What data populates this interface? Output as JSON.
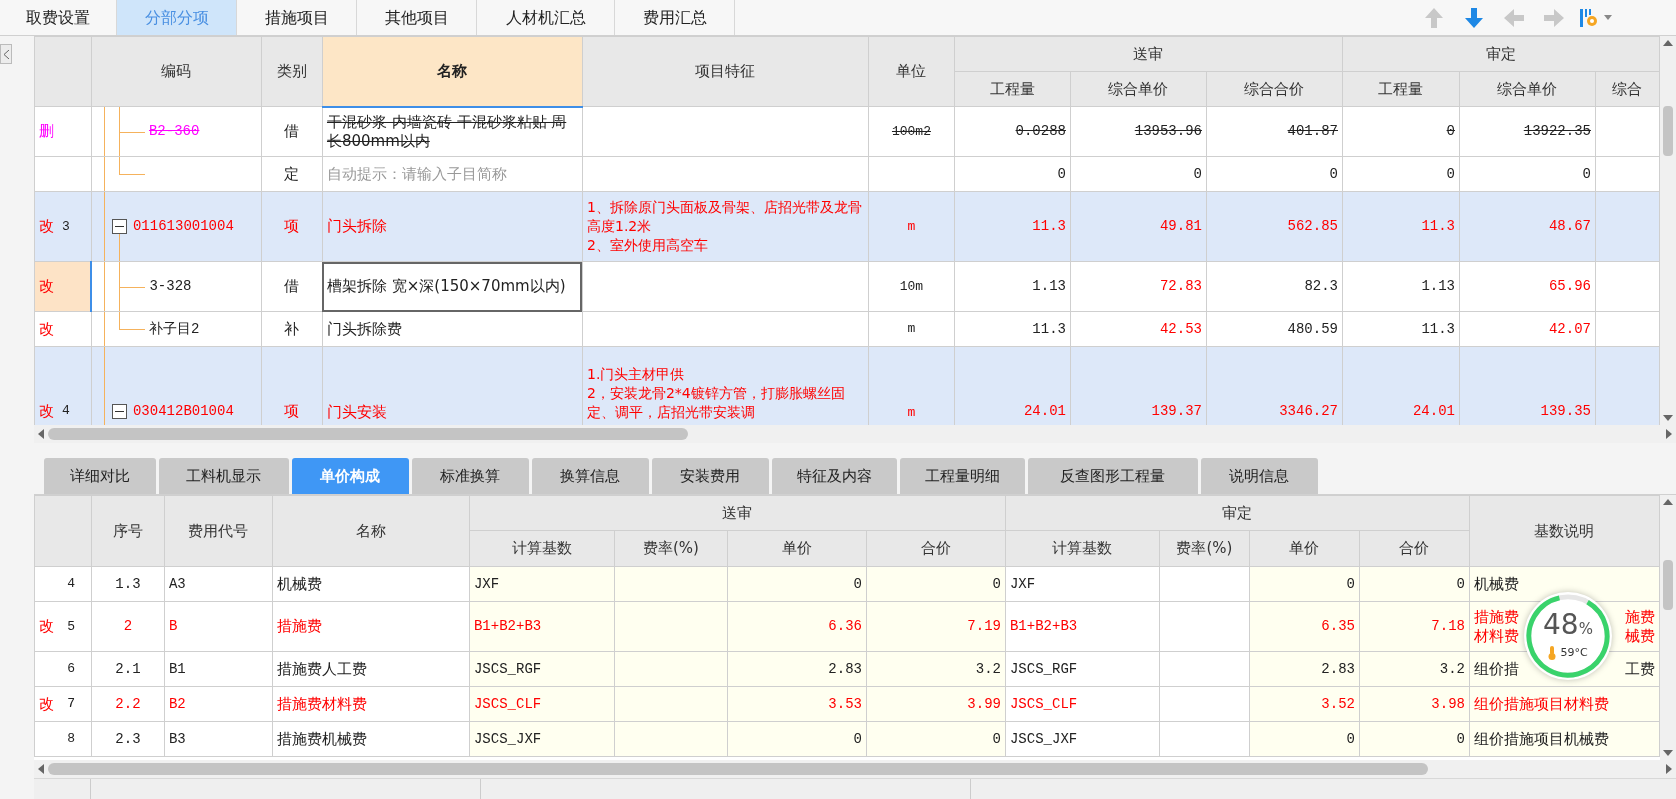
{
  "top_tabs": [
    {
      "label": "取费设置",
      "selected": false
    },
    {
      "label": "分部分项",
      "selected": true
    },
    {
      "label": "措施项目",
      "selected": false
    },
    {
      "label": "其他项目",
      "selected": false
    },
    {
      "label": "人材机汇总",
      "selected": false
    },
    {
      "label": "费用汇总",
      "selected": false
    }
  ],
  "toolbar": [
    {
      "kind": "up",
      "disabled": true
    },
    {
      "kind": "down",
      "disabled": false
    },
    {
      "kind": "left",
      "disabled": true
    },
    {
      "kind": "right",
      "disabled": true
    },
    {
      "kind": "settings",
      "disabled": false
    }
  ],
  "upper_table": {
    "columns": {
      "code": "编码",
      "type": "类别",
      "name": "名称",
      "feature": "项目特征",
      "unit": "单位"
    },
    "groups": [
      {
        "title": "送审",
        "columns": [
          "工程量",
          "综合单价",
          "综合合价"
        ]
      },
      {
        "title": "审定",
        "columns": [
          "工程量",
          "综合单价",
          "综合"
        ]
      }
    ],
    "rows": [
      {
        "kind": "sub",
        "status": "删",
        "deleted": true,
        "hint": false,
        "changed": false,
        "selected": false,
        "focused": false,
        "code": "B2-360",
        "type": "借",
        "name": "干混砂浆 内墙瓷砖 干混砂浆粘贴 周长800mm以内",
        "unit": "100m2",
        "cells": [
          {
            "text": "0.0288",
            "changed": false
          },
          {
            "text": "13953.96",
            "changed": false
          },
          {
            "text": "401.87",
            "changed": false
          },
          {
            "text": "0",
            "changed": false
          },
          {
            "text": "13922.35",
            "changed": false
          }
        ]
      },
      {
        "kind": "sub",
        "deleted": false,
        "hint": true,
        "changed": false,
        "selected": false,
        "focused": false,
        "type": "定",
        "name": "自动提示：请输入子目简称",
        "cells": [
          {
            "text": "0",
            "changed": false
          },
          {
            "text": "0",
            "changed": false
          },
          {
            "text": "0",
            "changed": false
          },
          {
            "text": "0",
            "changed": false
          },
          {
            "text": "0",
            "changed": false
          }
        ]
      },
      {
        "kind": "item",
        "status": "改",
        "number": "3",
        "expanded": true,
        "deleted": false,
        "hint": false,
        "changed": true,
        "selected": false,
        "focused": false,
        "code": "011613001004",
        "type": "项",
        "name": "门头拆除",
        "feature": [
          "1、拆除原门头面板及骨架、店招光带及龙骨高度1.2米",
          "2、室外使用高空车"
        ],
        "unit": "m",
        "cells": [
          {
            "text": "11.3",
            "changed": true
          },
          {
            "text": "49.81",
            "changed": true
          },
          {
            "text": "562.85",
            "changed": true
          },
          {
            "text": "11.3",
            "changed": true
          },
          {
            "text": "48.67",
            "changed": true
          }
        ]
      },
      {
        "kind": "sub",
        "status": "改",
        "deleted": false,
        "hint": false,
        "changed": false,
        "selected": true,
        "focused": true,
        "code": "3-328",
        "type": "借",
        "name": "槽架拆除 宽×深(150×70mm以内)",
        "unit": "10m",
        "cells": [
          {
            "text": "1.13",
            "changed": false
          },
          {
            "text": "72.83",
            "changed": true
          },
          {
            "text": "82.3",
            "changed": false
          },
          {
            "text": "1.13",
            "changed": false
          },
          {
            "text": "65.96",
            "changed": true
          }
        ]
      },
      {
        "kind": "sub",
        "status": "改",
        "deleted": false,
        "hint": false,
        "changed": false,
        "selected": false,
        "focused": false,
        "code": "补子目2",
        "type": "补",
        "name": "门头拆除费",
        "unit": "m",
        "cells": [
          {
            "text": "11.3",
            "changed": false
          },
          {
            "text": "42.53",
            "changed": true
          },
          {
            "text": "480.59",
            "changed": false
          },
          {
            "text": "11.3",
            "changed": false
          },
          {
            "text": "42.07",
            "changed": true
          }
        ]
      },
      {
        "kind": "item",
        "status": "改",
        "number": "4",
        "expanded": true,
        "deleted": false,
        "hint": false,
        "changed": true,
        "selected": false,
        "focused": false,
        "code": "030412B01004",
        "type": "项",
        "name": "门头安装",
        "feature": [
          "1.门头主材甲供",
          "2，安装龙骨2*4镀锌方管，打膨胀螺丝固定、调平，店招光带安装调"
        ],
        "unit": "m",
        "cells": [
          {
            "text": "24.01",
            "changed": true
          },
          {
            "text": "139.37",
            "changed": true
          },
          {
            "text": "3346.27",
            "changed": true
          },
          {
            "text": "24.01",
            "changed": true
          },
          {
            "text": "139.35",
            "changed": true
          }
        ]
      }
    ]
  },
  "detail_tabs": [
    {
      "label": "详细对比",
      "selected": false
    },
    {
      "label": "工料机显示",
      "selected": false
    },
    {
      "label": "单价构成",
      "selected": true
    },
    {
      "label": "标准换算",
      "selected": false
    },
    {
      "label": "换算信息",
      "selected": false
    },
    {
      "label": "安装费用",
      "selected": false
    },
    {
      "label": "特征及内容",
      "selected": false
    },
    {
      "label": "工程量明细",
      "selected": false
    },
    {
      "label": "反查图形工程量",
      "selected": false
    },
    {
      "label": "说明信息",
      "selected": false
    }
  ],
  "price_table": {
    "columns": {
      "seq": "序号",
      "code": "费用代号",
      "name": "名称",
      "desc": "基数说明"
    },
    "groups": [
      {
        "title": "送审",
        "columns": [
          "计算基数",
          "费率(%)",
          "单价",
          "合价"
        ]
      },
      {
        "title": "审定",
        "columns": [
          "计算基数",
          "费率(%)",
          "单价",
          "合价"
        ]
      }
    ],
    "rows": [
      {
        "number": "4",
        "changed": false,
        "seq": "1.3",
        "code": "A3",
        "name": "机械费",
        "s_base": "JXF",
        "s_price": "0",
        "s_total": "0",
        "a_base": "JXF",
        "a_price": "0",
        "a_total": "0",
        "desc": "机械费"
      },
      {
        "status": "改",
        "number": "5",
        "changed": true,
        "seq": "2",
        "code": "B",
        "name": "措施费",
        "s_base": "B1+B2+B3",
        "s_price": "6.36",
        "s_total": "7.19",
        "a_base": "B1+B2+B3",
        "a_price": "6.35",
        "a_total": "7.18",
        "desc_lines": [
          [
            "措施费",
            "施费"
          ],
          [
            "材料费",
            "械费"
          ]
        ]
      },
      {
        "number": "6",
        "changed": false,
        "seq": "2.1",
        "code": "B1",
        "name": "措施费人工费",
        "s_base": "JSCS_RGF",
        "s_price": "2.83",
        "s_total": "3.2",
        "a_base": "JSCS_RGF",
        "a_price": "2.83",
        "a_total": "3.2",
        "desc_lines": [
          [
            "组价措",
            "工费"
          ]
        ]
      },
      {
        "status": "改",
        "number": "7",
        "changed": true,
        "seq": "2.2",
        "code": "B2",
        "name": "措施费材料费",
        "s_base": "JSCS_CLF",
        "s_price": "3.53",
        "s_total": "3.99",
        "a_base": "JSCS_CLF",
        "a_price": "3.52",
        "a_total": "3.98",
        "desc": "组价措施项目材料费"
      },
      {
        "number": "8",
        "changed": false,
        "seq": "2.3",
        "code": "B3",
        "name": "措施费机械费",
        "s_base": "JSCS_JXF",
        "s_price": "0",
        "s_total": "0",
        "a_base": "JSCS_JXF",
        "a_price": "0",
        "a_total": "0",
        "desc": "组价措施项目机械费"
      }
    ]
  },
  "gauge": {
    "percent": "48",
    "unit": "%",
    "temperature": "59°C"
  }
}
